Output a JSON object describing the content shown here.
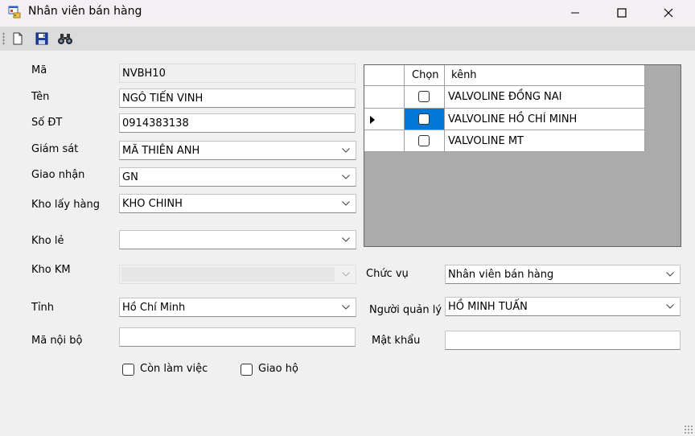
{
  "window": {
    "title": "Nhân viên bán hàng"
  },
  "form": {
    "ma": {
      "label": "Mã",
      "value": "NVBH10"
    },
    "ten": {
      "label": "Tên",
      "value": "NGÔ TIẾN VINH"
    },
    "so_dt": {
      "label": "Số ĐT",
      "value": "0914383138"
    },
    "giam_sat": {
      "label": "Giám sát",
      "value": "MÃ THIÊN ANH"
    },
    "giao_nhan": {
      "label": "Giao nhận",
      "value": "GN"
    },
    "kho_lay_hang": {
      "label": "Kho lấy hàng",
      "value": "KHO CHINH"
    },
    "kho_le": {
      "label": "Kho lẻ",
      "value": ""
    },
    "kho_km": {
      "label": "Kho KM",
      "value": ""
    },
    "tinh": {
      "label": "Tỉnh",
      "value": "Hồ Chí Minh"
    },
    "ma_noi_bo": {
      "label": "Mã nội bộ",
      "value": ""
    },
    "chuc_vu": {
      "label": "Chức vụ",
      "value": "Nhân viên bán hàng"
    },
    "nguoi_quan_ly": {
      "label": "Người quản lý",
      "value": "HỒ MINH TUẤN"
    },
    "mat_khau": {
      "label": "Mật khẩu",
      "value": ""
    },
    "con_lam_viec": {
      "label": "Còn làm việc",
      "checked": false
    },
    "giao_ho": {
      "label": "Giao hộ",
      "checked": false
    }
  },
  "grid": {
    "columns": [
      "Chọn",
      "kênh"
    ],
    "rows": [
      {
        "checked": false,
        "kenh": "VALVOLINE ĐỒNG NAI",
        "current": false
      },
      {
        "checked": false,
        "kenh": "VALVOLINE HỒ CHÍ MINH",
        "current": true
      },
      {
        "checked": false,
        "kenh": "VALVOLINE MT",
        "current": false
      }
    ]
  },
  "toolbar": {
    "buttons": [
      "new-icon",
      "save-icon",
      "find-icon"
    ]
  },
  "colors": {
    "selection": "#0078d7",
    "grid_bg": "#ababab",
    "form_bg": "#f0f0f0",
    "titlebar_bg": "#f3eff3"
  }
}
